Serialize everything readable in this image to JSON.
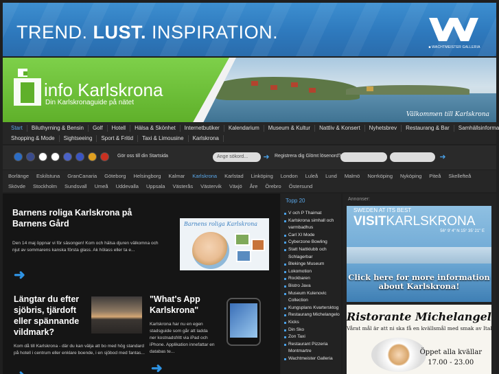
{
  "banner": {
    "text_a": "TREND.",
    "text_b": "LUST.",
    "text_c": "INSPIRATION.",
    "logo_caption": "■ WACHTMEISTER GALLERIA"
  },
  "header": {
    "logo_title": "info Karlskrona",
    "logo_subtitle": "Din Karlskronaguide på nätet",
    "photo_caption": "Välkommen till Karlskrona"
  },
  "nav": {
    "row1": [
      "Start",
      "Biluthyrning & Bensin",
      "Golf",
      "Hotell",
      "Hälsa & Skönhet",
      "Internetbutiker",
      "Kalendarium",
      "Museum & Kultur",
      "Nattliv & Konsert",
      "Nyhetsbrev",
      "Restaurang & Bar",
      "Samhällsinformation"
    ],
    "row2": [
      "Shopping & Mode",
      "Sightseeing",
      "Sport & Fritid",
      "Taxi & Limousine",
      "Karlskrona"
    ],
    "active": "Start"
  },
  "toolbar": {
    "flags": [
      {
        "name": "sweden-flag-icon",
        "color": "#2b6cc4"
      },
      {
        "name": "uk-flag-icon",
        "color": "#3a4b8c"
      },
      {
        "name": "finland-flag-icon",
        "color": "#ffffff"
      },
      {
        "name": "japan-flag-icon",
        "color": "#ffffff"
      },
      {
        "name": "russia-flag-icon",
        "color": "#4a62c6"
      },
      {
        "name": "france-flag-icon",
        "color": "#3a54c2"
      },
      {
        "name": "spain-flag-icon",
        "color": "#e0a020"
      },
      {
        "name": "germany-flag-icon",
        "color": "#c83020"
      }
    ],
    "startsida": "Gör oss till din Startsida",
    "search_placeholder": "Ange sökord...",
    "register_text": "Registrera dig Glömt lösenord?"
  },
  "cities": {
    "row1": [
      "Borlänge",
      "Eskilstuna",
      "GranCanaria",
      "Göteborg",
      "Helsingborg",
      "Kalmar",
      "Karlskrona",
      "Karlstad",
      "Linköping",
      "London",
      "Luleå",
      "Lund",
      "Malmö",
      "Norrköping",
      "Nyköping",
      "Piteå",
      "Skellefteå"
    ],
    "row2": [
      "Skövde",
      "Stockholm",
      "Sundsvall",
      "Umeå",
      "Uddevalla",
      "Uppsala",
      "Västerås",
      "Västervik",
      "Växjö",
      "Åre",
      "Örebro",
      "Östersund"
    ],
    "active": "Karlskrona"
  },
  "articles": [
    {
      "title": "Barnens roliga Karlskrona på Barnens Gård",
      "text": "Den 14 maj öppnar vi för säsongen! Kom och hälsa djuren välkomna och njut av sommarens kanska första glass. Ak hölass eller ta e...",
      "image_text": "Barnens roliga Karlskrona"
    },
    {
      "title": "Längtar du efter sjöbris, tjärdoft eller spännande vildmark?",
      "text": "Kom då till Karlskrona - där du kan välja att bo med hög standard på hotell i centrum eller enklare boende, i en sjöbod med fantas..."
    },
    {
      "title": "\"What's App Karlskrona\"",
      "text": "Karlskrona har nu en egen stadsguide som går att ladda ner kostnadsfritt via iPad och iPhone. Applikation innefattar en databas te..."
    }
  ],
  "topp20": {
    "title": "Topp 20",
    "items": [
      "V och P Thaimat",
      "Karlskrona simhall och varmbadhus",
      "Carl XI Mode",
      "Cyberzone Bowling",
      "Statt Nattklubb och Schlagerbar",
      "Blekinge Museum",
      "Lokomotion",
      "Rockbaren",
      "Bistro Java",
      "Museum Kulenovic Collection",
      "Kungsplans Kvartersktog",
      "Restaurang Michelangelo",
      "Kicks",
      "Din Sko",
      "Zon Taxi",
      "Restaurant Pizzeria Montmartre",
      "Wachtmeister Galleria"
    ]
  },
  "ads": {
    "label": "Annonser:",
    "ad1_top": "SWEDEN AT ITS BEST",
    "ad1_brand_a": "VISIT",
    "ad1_brand_b": "KARLSKRONA",
    "ad1_coords": "56° 9' 4\" N   15° 35' 21\" E",
    "ad1_click": "Click here for more information about Karlskrona!",
    "ad2_title": "Ristorante Michelangelo",
    "ad2_sub": "Vårat mål är att ni ska få en kvällsmål med smak av Italien",
    "ad2_open": "Öppet alla kvällar",
    "ad2_hours": "17.00 - 23.00"
  }
}
